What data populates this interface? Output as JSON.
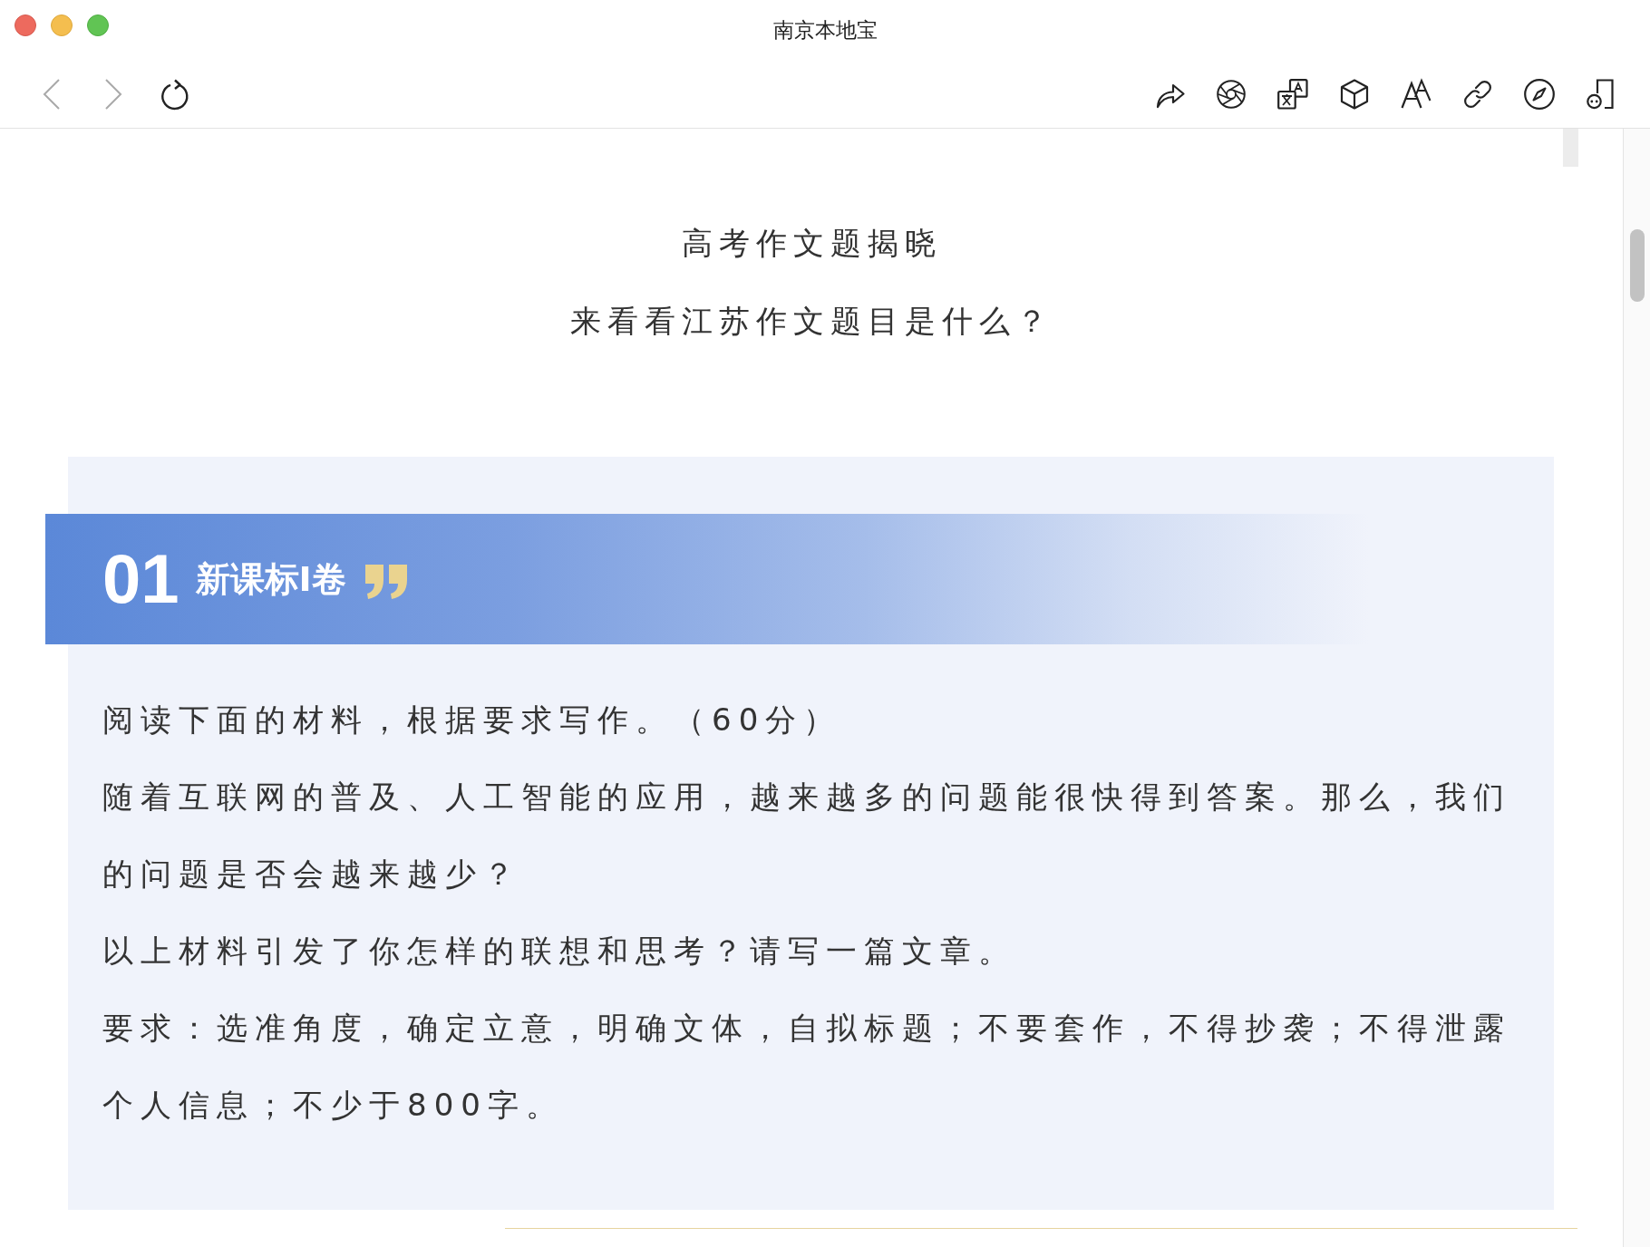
{
  "window": {
    "title": "南京本地宝"
  },
  "toolbar": {
    "nav_buttons": [
      {
        "kind": "back",
        "disabled": true
      },
      {
        "kind": "forward",
        "disabled": true
      },
      {
        "kind": "reload",
        "disabled": false
      }
    ]
  },
  "article": {
    "headings": [
      "高考作文题揭晓",
      "来看看江苏作文题目是什么？"
    ],
    "section": {
      "number": "01",
      "title": "新课标I卷",
      "paragraphs": [
        "阅读下面的材料，根据要求写作。（60分）",
        "随着互联网的普及、人工智能的应用，越来越多的问题能很快得到答案。那么，我们的问题是否会越来越少？",
        "以上材料引发了你怎样的联想和思考？请写一篇文章。",
        "要求：选准角度，确定立意，明确文体，自拟标题；不要套作，不得抄袭；不得泄露个人信息；不少于800字。"
      ]
    }
  }
}
